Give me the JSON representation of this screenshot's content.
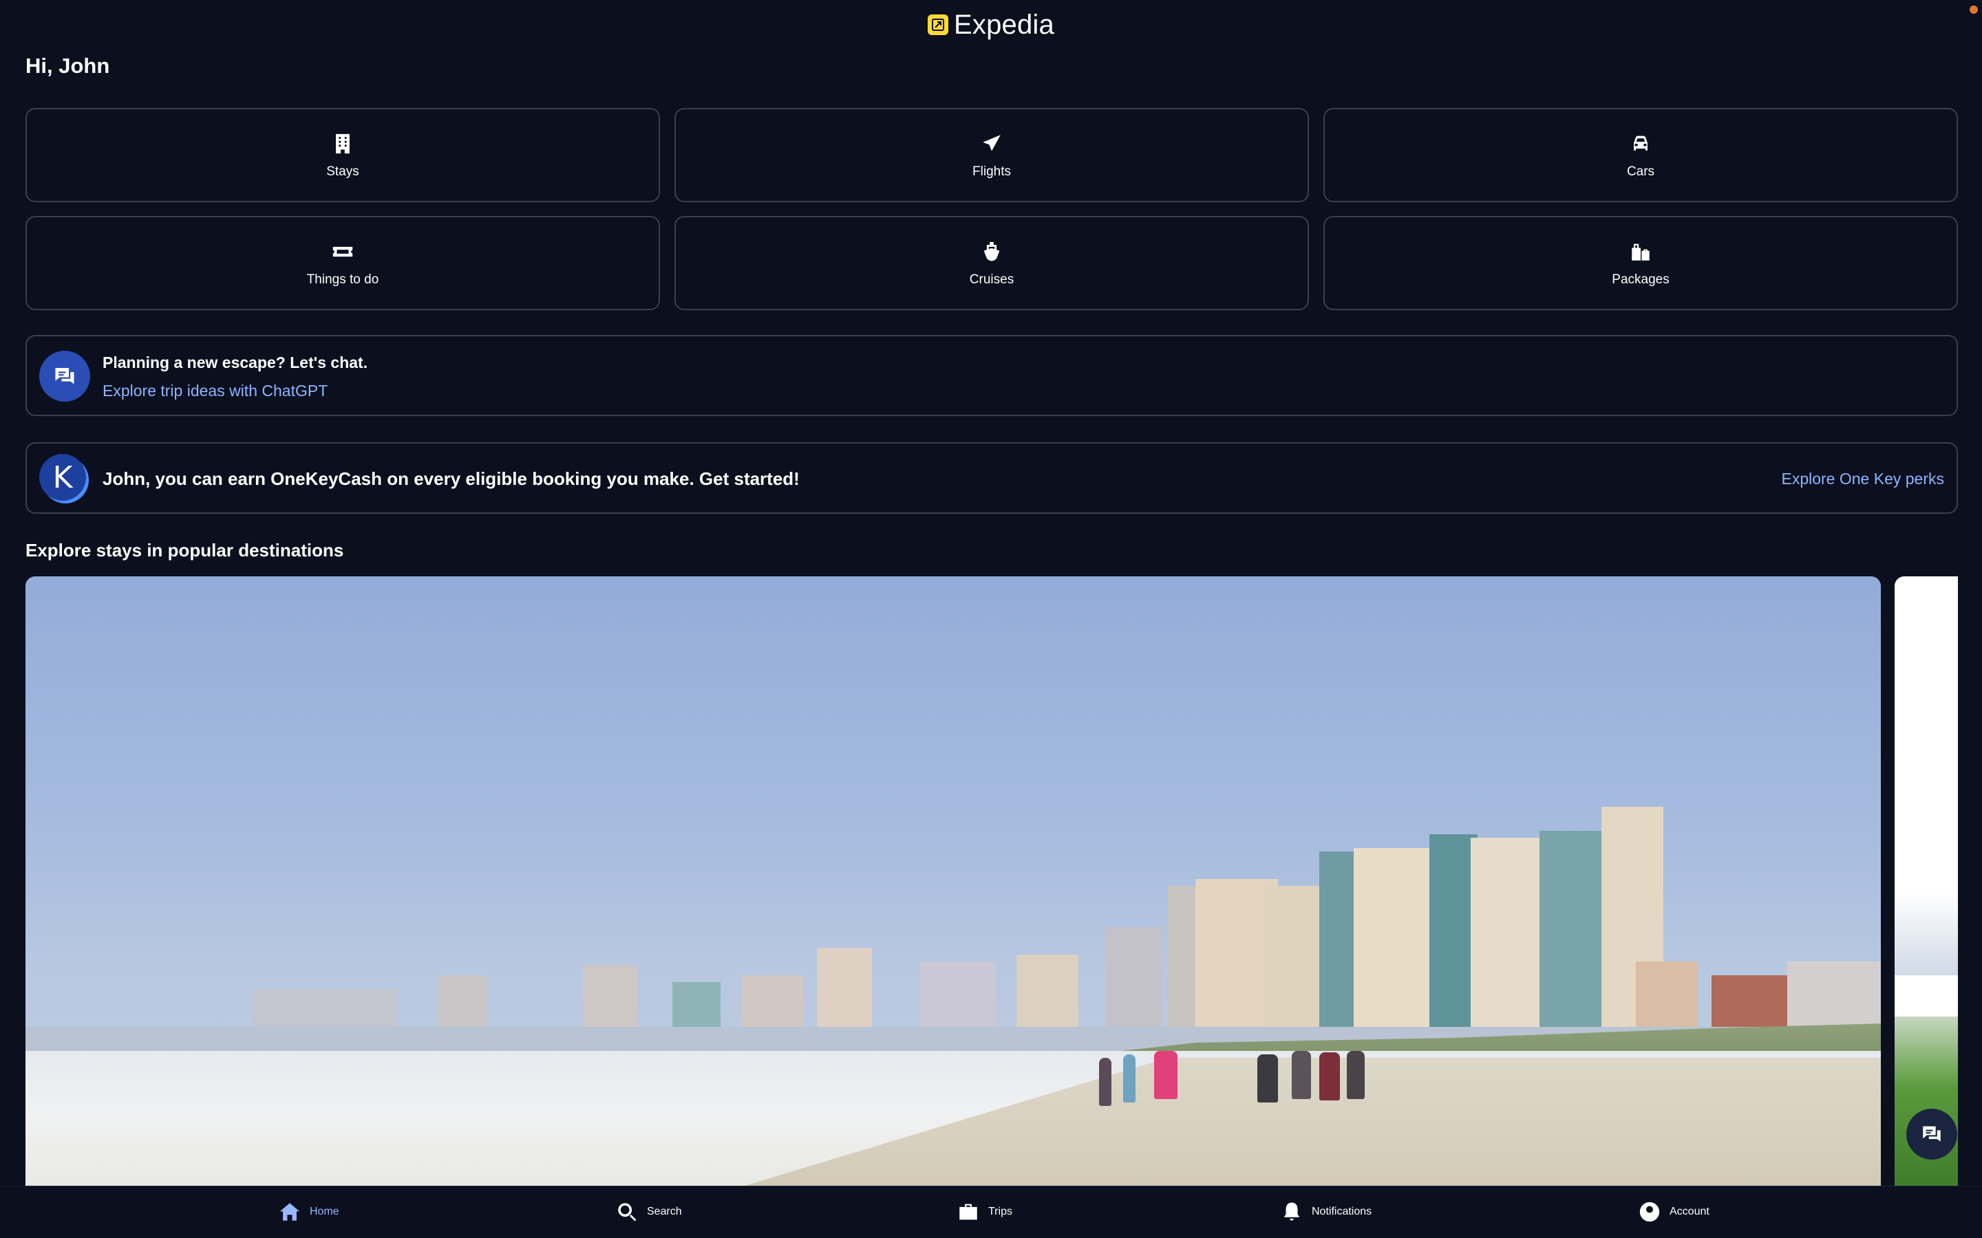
{
  "app": {
    "brand_name": "Expedia"
  },
  "greeting": "Hi, John",
  "categories": [
    {
      "label": "Stays",
      "icon": "building-icon"
    },
    {
      "label": "Flights",
      "icon": "airplane-icon"
    },
    {
      "label": "Cars",
      "icon": "car-icon"
    },
    {
      "label": "Things to do",
      "icon": "ticket-icon"
    },
    {
      "label": "Cruises",
      "icon": "ship-icon"
    },
    {
      "label": "Packages",
      "icon": "luggage-icon"
    }
  ],
  "chat_banner": {
    "title": "Planning a new escape? Let's chat.",
    "link": "Explore trip ideas with ChatGPT",
    "icon": "chat-bubbles-icon"
  },
  "onekey_banner": {
    "icon_letter": "K",
    "text": "John, you can earn OneKeyCash on every eligible booking you make. Get started!",
    "link": "Explore One Key perks"
  },
  "section_title": "Explore stays in popular destinations",
  "bottom_nav": [
    {
      "label": "Home",
      "icon": "home-icon",
      "active": true
    },
    {
      "label": "Search",
      "icon": "search-icon",
      "active": false
    },
    {
      "label": "Trips",
      "icon": "briefcase-icon",
      "active": false
    },
    {
      "label": "Notifications",
      "icon": "bell-icon",
      "active": false
    },
    {
      "label": "Account",
      "icon": "account-icon",
      "active": false
    }
  ],
  "colors": {
    "background": "#0b0f1e",
    "link": "#8fb4ff",
    "brand_yellow": "#fddb32",
    "active_nav": "#9bb7ff",
    "tile_border": "#3a3f52"
  }
}
